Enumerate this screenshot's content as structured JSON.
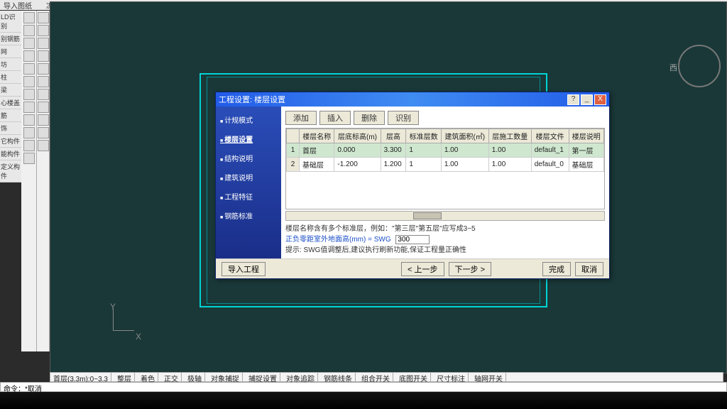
{
  "top_menu": {
    "import": "导入图纸",
    "freeze": "冻结图层"
  },
  "left_labels": [
    "LD识别",
    "别钢筋",
    "网",
    "坊",
    "柱",
    "梁",
    "心楼盖",
    "筋",
    "饰",
    "它构件",
    "能构件",
    "定义构件"
  ],
  "status_bar": {
    "coord": "首层(3.3m):0~3.3",
    "items": [
      "整层",
      "着色",
      "正交",
      "极轴",
      "对象捕捉",
      "捕捉设置",
      "对象追踪",
      "钢筋线条",
      "组合开关",
      "底图开关",
      "尺寸标注",
      "轴网开关"
    ]
  },
  "cmd_line": "命令：*取消",
  "compass": {
    "w": "西"
  },
  "dialog": {
    "title": "工程设置: 楼层设置",
    "title_buttons": {
      "help": "?",
      "min": "_",
      "close": "X"
    },
    "nav": [
      {
        "label": "计规模式",
        "active": false
      },
      {
        "label": "楼层设置",
        "active": true
      },
      {
        "label": "结构说明",
        "active": false
      },
      {
        "label": "建筑说明",
        "active": false
      },
      {
        "label": "工程特征",
        "active": false
      },
      {
        "label": "钢筋标准",
        "active": false
      }
    ],
    "toolbar": {
      "add": "添加",
      "insert": "插入",
      "delete": "删除",
      "identify": "识别"
    },
    "table": {
      "headers": [
        "",
        "楼层名称",
        "层底标高(m)",
        "层高",
        "标准层数",
        "建筑面积(㎡)",
        "层施工数量",
        "楼层文件",
        "楼层说明"
      ],
      "rows": [
        {
          "n": "1",
          "name": "首层",
          "elev": "0.000",
          "height": "3.300",
          "std": "1",
          "area": "1.00",
          "qty": "1.00",
          "file": "default_1",
          "desc": "第一层",
          "selected": true
        },
        {
          "n": "2",
          "name": "基础层",
          "elev": "-1.200",
          "height": "1.200",
          "std": "1",
          "area": "1.00",
          "qty": "1.00",
          "file": "default_0",
          "desc": "基础层",
          "selected": false
        }
      ]
    },
    "hints": {
      "line1": "楼层名称含有多个标准层，例如：\"第三层\"第五层\"应写成3~5",
      "line2a": "正负零距室外地面高(mm) = SWG",
      "swg_value": "300",
      "line3": "提示: SWG值调整后,建议执行刷新功能,保证工程量正确性"
    },
    "footer": {
      "import": "导入工程",
      "prev": "< 上一步",
      "next": "下一步 >",
      "finish": "完成",
      "cancel": "取消"
    }
  }
}
